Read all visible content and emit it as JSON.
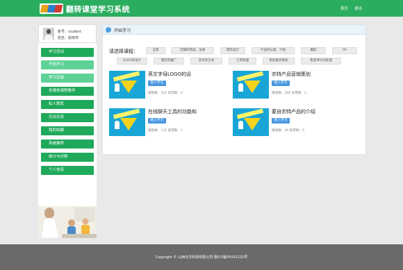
{
  "header": {
    "title": "翻转课堂学习系统",
    "nav": [
      "首页",
      "退出"
    ]
  },
  "user": {
    "account": "账号：student",
    "name": "姓名：赵晓伟"
  },
  "sidebar": {
    "items": [
      "学习活动",
      "开始学习",
      "学习记录",
      "多媒体课程教学",
      "私人题库",
      "互动交流",
      "我的收藏",
      "系统推荐",
      "统计与诊断",
      "个人信息"
    ],
    "active_index": 1
  },
  "main": {
    "title": "开始学习",
    "course_label": "请选择课程：",
    "tags": [
      "全部",
      "店铺的筛选、注册",
      "网店设计",
      "产品的分类、介绍",
      "摄影",
      "PS",
      "LOGO的设计",
      "网店的推广",
      "支付的方式",
      "订单处理",
      "售后服务帮助",
      "售后评价的处理"
    ],
    "cards": [
      {
        "title": "英文字母LOGO的设",
        "button": "进入学习",
        "stats": "播放数：202  投票数：0"
      },
      {
        "title": "农特产品营销策划",
        "button": "进入学习",
        "stats": "播放数：288  投票数：2"
      },
      {
        "title": "在线聊天工具的功能和",
        "button": "进入学习",
        "stats": "播放数：131  投票数：1"
      },
      {
        "title": "蒙自农特产品的介绍",
        "button": "进入学习",
        "stats": "播放数：49  投票数：0"
      }
    ]
  },
  "footer": {
    "text": "Copyright © 山西光华科技有限公司 晋ICP备05002232号"
  },
  "colors": {
    "header_green": "#2bad60",
    "menu_green": "#1fa95a",
    "menu_active": "#5ed196",
    "button_blue": "#4b98e0",
    "footer_gray": "#6a6a6a"
  }
}
